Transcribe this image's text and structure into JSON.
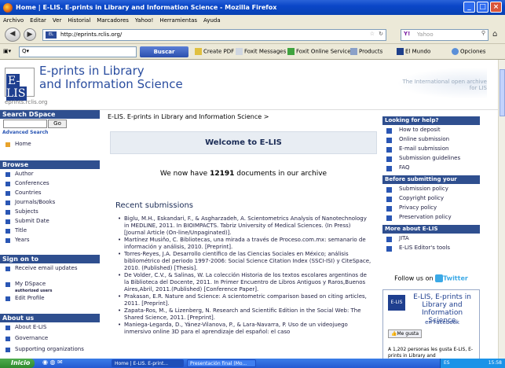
{
  "window": {
    "title": "Home | E-LIS. E-prints in Library and Information Science - Mozilla Firefox"
  },
  "menu": [
    "Archivo",
    "Editar",
    "Ver",
    "Historial",
    "Marcadores",
    "Yahoo!",
    "Herramientas",
    "Ayuda"
  ],
  "nav": {
    "url": "http://eprints.rclis.org/",
    "search_placeholder": "Yahoo"
  },
  "toolbar": {
    "buscar": "Buscar",
    "items": [
      "Create PDF",
      "Foxit Messages",
      "Foxit Online Services",
      "Products",
      "El Mundo",
      "Opciones"
    ]
  },
  "header": {
    "logo_text": "E-LIS",
    "title_line1": "E-prints in Library",
    "title_line2": "and Information Science",
    "logo_url": "eprints.rclis.org",
    "archive_tag": "The International open archive for LIS"
  },
  "left": {
    "search_title": "Search DSpace",
    "go": "Go",
    "advanced": "Advanced Search",
    "home": "Home",
    "browse_title": "Browse",
    "browse": [
      "Author",
      "Conferences",
      "Countries",
      "Journals/Books",
      "Subjects",
      "Submit Date",
      "Title",
      "Years"
    ],
    "signon_title": "Sign on to",
    "signon": [
      {
        "label": "Receive email updates",
        "sub": ""
      },
      {
        "label": "My DSpace",
        "sub": "authorized users"
      },
      {
        "label": "Edit Profile",
        "sub": ""
      }
    ],
    "about_title": "About us",
    "about": [
      "About E-LIS",
      "Governance",
      "Supporting organizations"
    ]
  },
  "main": {
    "breadcrumb": "E-LIS. E-prints in Library and Information Science >",
    "welcome": "Welcome to E-LIS",
    "count_pre": "We now have ",
    "count_num": "12191",
    "count_post": " documents in our archive",
    "recent_title": "Recent submissions",
    "submissions": [
      "Biglu, M.H., Eskandari, F., & Asgharzadeh, A. Scientometrics Analysis of Nanotechnology in MEDLINE, 2011. In BIOIMPACTS. Tabriz University of Medical Sciences. (In Press) [Journal Article (On-line/Unpaginated)].",
      "Martínez Musiño, C. Bibliotecas, una mirada a través de Proceso.com.mx: semanario de información y análisis, 2010. [Preprint].",
      "Torres-Reyes, J.A. Desarrollo científico de las Ciencias Sociales en México; análisis bibliométrico del periodo 1997-2006: Social Science Citation Index (SSCI-ISI) y CiteSpace, 2010. (Published) [Thesis].",
      "De Volder, C.V., & Salinas, W. La colección Historia de los textos escolares argentinos de la Biblioteca del Docente, 2011. In Primer Encuentro de Libros Antiguos y Raros,Buenos Aires,Abril, 2011.(Published) [Conference Paper].",
      "Prakasan, E.R. Nature and Science: A scientometric comparison based on citing articles, 2011. [Preprint].",
      "Zapata-Ros, M., & Lizenberg, N. Research and Scientific Edition in the Social Web: The Shared Science, 2011. [Preprint].",
      "Maniega-Legarda, D., Yánez-Vilanova, P., & Lara-Navarra, P. Uso de un videojuego inmersivo online 3D para el aprendizaje del español: el caso"
    ]
  },
  "right": {
    "help_title": "Looking for help?",
    "help": [
      "How to deposit",
      "Online submission",
      "E-mail submission",
      "Submission guidelines",
      "FAQ"
    ],
    "before_title": "Before submitting your papers",
    "before": [
      "Submission policy",
      "Copyright policy",
      "Privacy policy",
      "Preservation policy"
    ],
    "more_title": "More about E-LIS",
    "more": [
      "JITA",
      "E-LIS Editor's tools"
    ],
    "follow": "Follow us on",
    "twitter": "Twitter",
    "fb_logo": "E-LIS",
    "fb_name": "E-LIS, E-prints in Library and Information Science",
    "fb_sub": "en Facebook",
    "fb_like": "Me gusta",
    "fb_count": "A 1,202 personas les gusta E-LIS, E-prints in Library and"
  },
  "taskbar": {
    "start": "Inicio",
    "tasks": [
      "Home | E-LIS. E-print...",
      "Presentación final (Mo..."
    ],
    "tray": "ES",
    "clock": "15:58"
  }
}
